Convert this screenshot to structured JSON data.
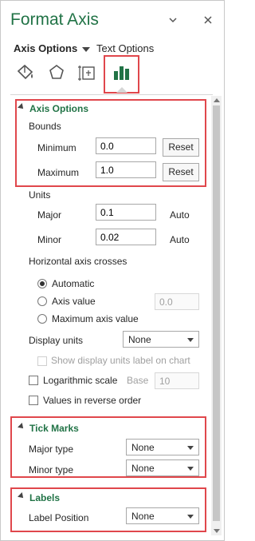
{
  "header": {
    "title": "Format Axis",
    "dropdown_icon": "chevron-down-icon",
    "close_icon": "close-icon"
  },
  "tabs": {
    "axis_options": "Axis Options",
    "text_options": "Text Options"
  },
  "icon_tabs": [
    "fill-line-icon",
    "effects-icon",
    "size-properties-icon",
    "axis-options-icon"
  ],
  "axis_options": {
    "header": "Axis Options",
    "bounds_label": "Bounds",
    "minimum_label": "Minimum",
    "minimum_value": "0.0",
    "maximum_label": "Maximum",
    "maximum_value": "1.0",
    "reset_label": "Reset",
    "units_label": "Units",
    "major_label": "Major",
    "major_value": "0.1",
    "major_auto": "Auto",
    "minor_label": "Minor",
    "minor_value": "0.02",
    "minor_auto": "Auto",
    "h_axis_crosses_label": "Horizontal axis crosses",
    "radio_automatic": "Automatic",
    "radio_axis_value": "Axis value",
    "axis_value_input": "0.0",
    "radio_max_axis_value": "Maximum axis value",
    "display_units_label": "Display units",
    "display_units_value": "None",
    "show_display_units_label": "Show display units label on chart",
    "log_scale_label": "Logarithmic scale",
    "base_label": "Base",
    "base_value": "10",
    "reverse_order_label": "Values in reverse order"
  },
  "tick_marks": {
    "header": "Tick Marks",
    "major_type_label": "Major type",
    "major_type_value": "None",
    "minor_type_label": "Minor type",
    "minor_type_value": "None"
  },
  "labels": {
    "header": "Labels",
    "label_position_label": "Label Position",
    "label_position_value": "None"
  },
  "colors": {
    "accent": "#217346",
    "highlight": "#e0474c"
  }
}
